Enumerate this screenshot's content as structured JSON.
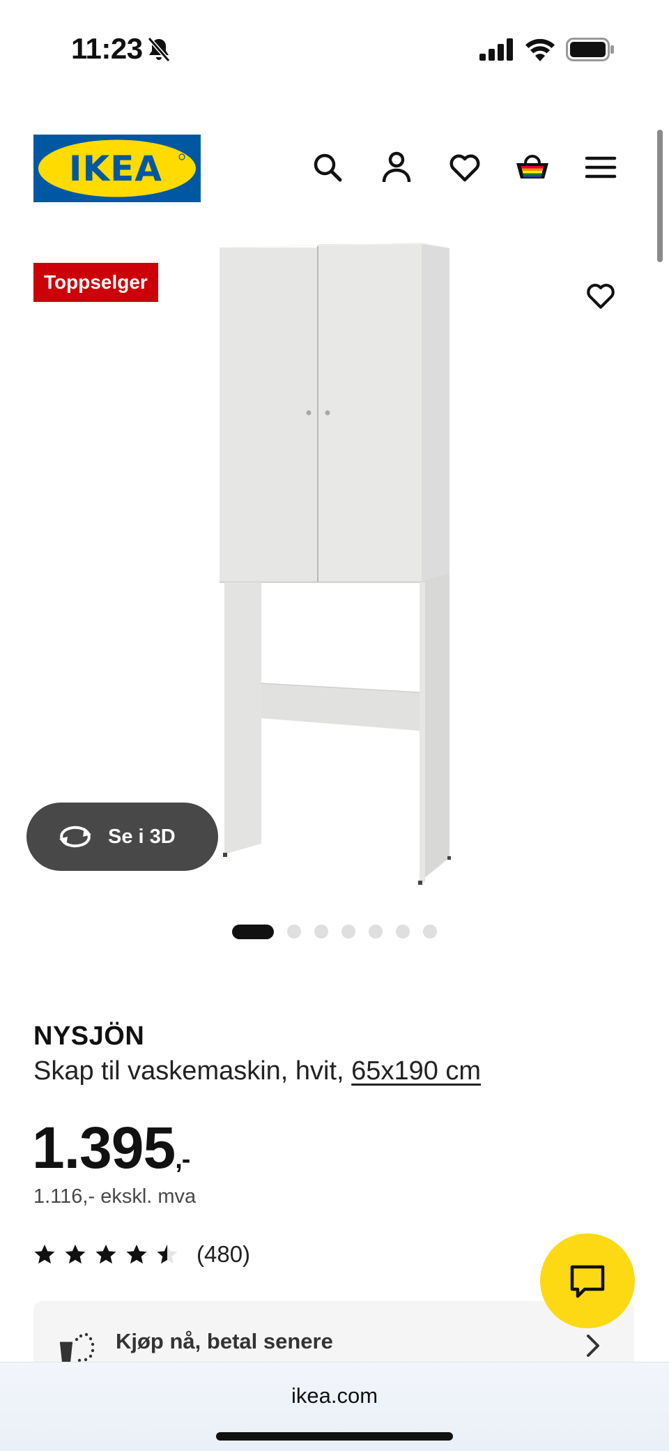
{
  "status_bar": {
    "time": "11:23",
    "icons": [
      "bell-slash-icon",
      "signal-icon",
      "wifi-icon",
      "battery-icon"
    ]
  },
  "header": {
    "logo_text": "IKEA",
    "icons": [
      "search-icon",
      "account-icon",
      "heart-icon",
      "basket-icon",
      "menu-icon"
    ]
  },
  "product_image": {
    "badge": "Toppselger",
    "view_3d_label": "Se i 3D",
    "image_count": 7,
    "active_image": 1
  },
  "product": {
    "name": "NYSJÖN",
    "description": "Skap til vaskemaskin, hvit,",
    "size_link": "65x190 cm",
    "price": "1.395",
    "price_suffix": ",-",
    "price_ex_vat": "1.116,- ekskl. mva",
    "rating": 4.5,
    "rating_max": 5,
    "review_count": "(480)"
  },
  "payment": {
    "label": "Kjøp nå, betal senere"
  },
  "browser": {
    "url": "ikea.com"
  },
  "colors": {
    "ikea_blue": "#0058a3",
    "ikea_yellow": "#ffdb00",
    "badge_red": "#cc0008",
    "chat_yellow": "#fcd913"
  }
}
